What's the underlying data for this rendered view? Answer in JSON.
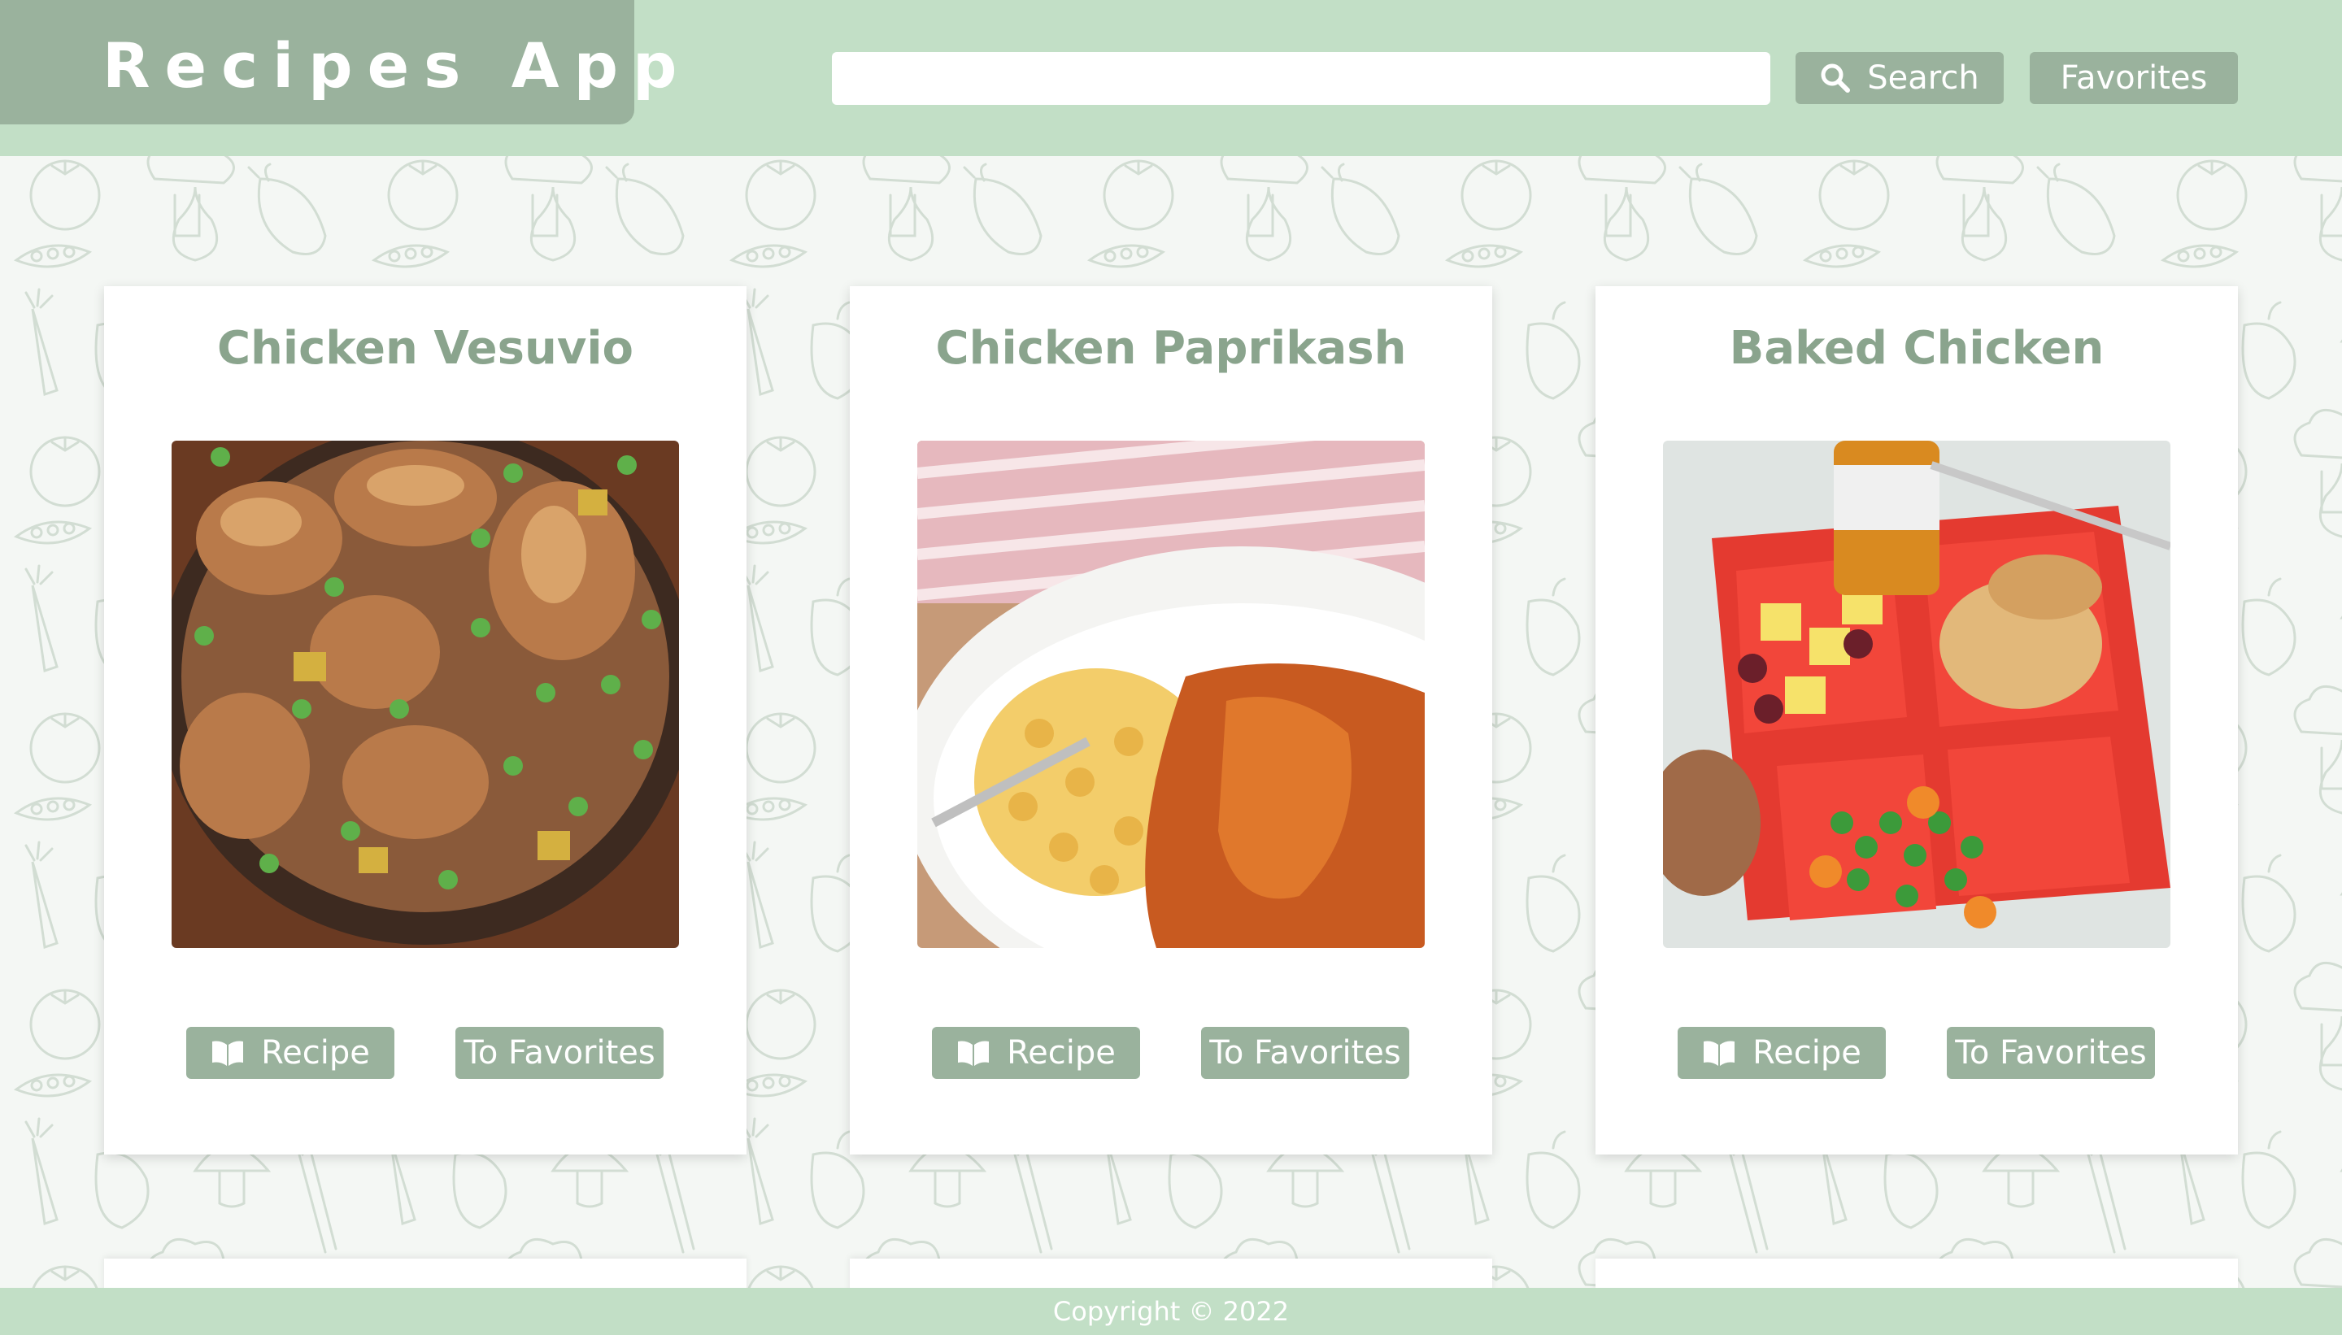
{
  "header": {
    "app_title": "Recipes App",
    "search": {
      "value": "",
      "placeholder": "",
      "button_label": "Search",
      "button_icon": "search-icon"
    },
    "favorites_label": "Favorites"
  },
  "recipes": [
    {
      "title": "Chicken Vesuvio",
      "image": "chicken-vesuvio-photo",
      "recipe_label": "Recipe",
      "recipe_icon": "book-icon",
      "favorite_label": "To Favorites"
    },
    {
      "title": "Chicken Paprikash",
      "image": "chicken-paprikash-photo",
      "recipe_label": "Recipe",
      "recipe_icon": "book-icon",
      "favorite_label": "To Favorites"
    },
    {
      "title": "Baked Chicken",
      "image": "baked-chicken-photo",
      "recipe_label": "Recipe",
      "recipe_icon": "book-icon",
      "favorite_label": "To Favorites"
    }
  ],
  "footer": {
    "copyright": "Copyright © 2022"
  },
  "colors": {
    "header_bg": "#c2dfc6",
    "accent": "#9ab29d",
    "title_text": "#8aa48d",
    "page_bg": "#f4f7f4"
  }
}
